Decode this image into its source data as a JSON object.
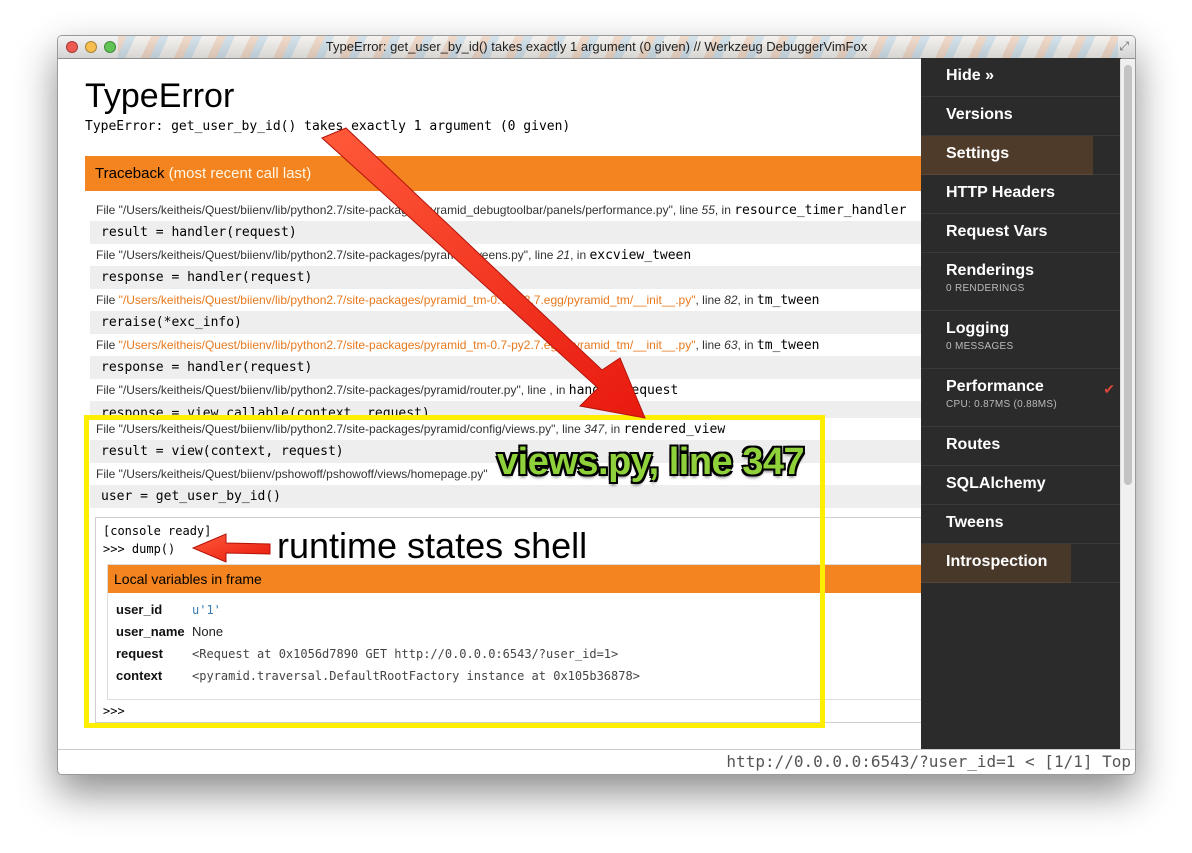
{
  "window": {
    "title": "TypeError: get_user_by_id() takes exactly 1 argument (0 given) // Werkzeug DebuggerVimFox"
  },
  "error": {
    "type": "TypeError",
    "message": "TypeError: get_user_by_id() takes exactly 1 argument (0 given)"
  },
  "traceback": {
    "title": "Traceback",
    "subtitle": "(most recent call last)",
    "frames": [
      {
        "file": "\"/Users/keitheis/Quest/biienv/lib/python2.7/site-packages/pyramid_debugtoolbar/panels/performance.py\"",
        "line": "55",
        "func": "resource_timer_handler",
        "code": "result = handler(request)"
      },
      {
        "file": "\"/Users/keitheis/Quest/biienv/lib/python2.7/site-packages/pyramid/tweens.py\"",
        "line": "21",
        "func": "excview_tween",
        "code": "response = handler(request)"
      },
      {
        "file": "\"/Users/keitheis/Quest/biienv/lib/python2.7/site-packages/pyramid_tm-0.7-py2.7.egg/pyramid_tm/__init__.py\"",
        "line": "82",
        "func": "tm_tween",
        "code": "reraise(*exc_info)"
      },
      {
        "file": "\"/Users/keitheis/Quest/biienv/lib/python2.7/site-packages/pyramid_tm-0.7-py2.7.egg/pyramid_tm/__init__.py\"",
        "line": "63",
        "func": "tm_tween",
        "code": "response = handler(request)"
      },
      {
        "file": "\"/Users/keitheis/Quest/biienv/lib/python2.7/site-packages/pyramid/router.py\"",
        "line": "",
        "func": "handle_request",
        "code": "response = view_callable(context, request)"
      },
      {
        "file": "\"/Users/keitheis/Quest/biienv/lib/python2.7/site-packages/pyramid/config/views.py\"",
        "line": "347",
        "func": "rendered_view",
        "code": "result = view(context, request)"
      },
      {
        "file": "\"/Users/keitheis/Quest/biienv/pshowoff/pshowoff/views/homepage.py\"",
        "line": "",
        "func": "",
        "code": "user = get_user_by_id()"
      }
    ]
  },
  "console": {
    "ready": "[console ready]",
    "command": ">>> dump()",
    "prompt": ">>>",
    "locals_title": "Local variables in frame",
    "locals": [
      {
        "name": "user_id",
        "value": "u'1'"
      },
      {
        "name": "user_name",
        "value": "None"
      },
      {
        "name": "request",
        "value": "<Request at 0x1056d7890 GET http://0.0.0.0:6543/?user_id=1>"
      },
      {
        "name": "context",
        "value": "<pyramid.traversal.DefaultRootFactory instance at 0x105b36878>"
      }
    ]
  },
  "debug_toolbar": {
    "hide": "Hide »",
    "items": [
      {
        "label": "Versions"
      },
      {
        "label": "Settings"
      },
      {
        "label": "HTTP Headers"
      },
      {
        "label": "Request Vars"
      },
      {
        "label": "Renderings",
        "sub": "0 RENDERINGS"
      },
      {
        "label": "Logging",
        "sub": "0 MESSAGES"
      },
      {
        "label": "Performance",
        "sub": "CPU: 0.87MS (0.88MS)"
      },
      {
        "label": "Routes"
      },
      {
        "label": "SQLAlchemy"
      },
      {
        "label": "Tweens"
      },
      {
        "label": "Introspection"
      }
    ]
  },
  "statusbar": {
    "text": "http://0.0.0.0:6543/?user_id=1 < [1/1] Top"
  },
  "annotations": {
    "views_label": "views.py, line 347",
    "shell_label": "runtime states shell"
  },
  "colors": {
    "accent_orange": "#f3841f",
    "toolbar_bg": "#2b2b2b",
    "highlight_yellow": "#ffee00",
    "arrow_red": "#f02a1b",
    "label_green": "#8fd13a"
  }
}
